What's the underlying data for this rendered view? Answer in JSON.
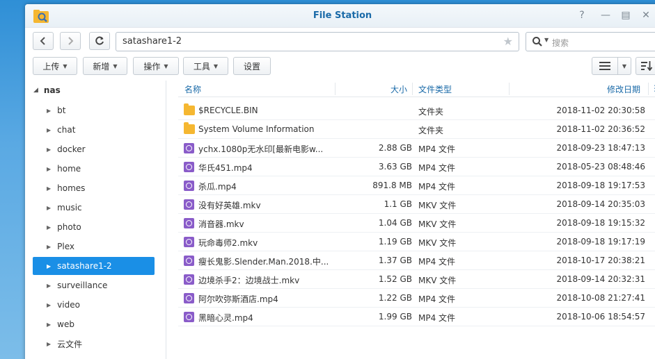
{
  "window": {
    "title": "File Station"
  },
  "address": {
    "path": "satashare1-2"
  },
  "search": {
    "placeholder": "搜索"
  },
  "toolbar": {
    "upload": "上传",
    "create": "新增",
    "action": "操作",
    "tools": "工具",
    "settings": "设置"
  },
  "sidebar": {
    "root": "nas",
    "items": [
      {
        "label": "bt"
      },
      {
        "label": "chat"
      },
      {
        "label": "docker"
      },
      {
        "label": "home"
      },
      {
        "label": "homes"
      },
      {
        "label": "music"
      },
      {
        "label": "photo"
      },
      {
        "label": "Plex"
      },
      {
        "label": "satashare1-2"
      },
      {
        "label": "surveillance"
      },
      {
        "label": "video"
      },
      {
        "label": "web"
      },
      {
        "label": "云文件"
      }
    ],
    "selected": "satashare1-2"
  },
  "columns": {
    "name": "名称",
    "size": "大小",
    "type": "文件类型",
    "modified": "修改日期"
  },
  "files": [
    {
      "icon": "folder-icon",
      "name": "$RECYCLE.BIN",
      "size": "",
      "type": "文件夹",
      "modified": "2018-11-02 20:30:58"
    },
    {
      "icon": "folder-icon",
      "name": "System Volume Information",
      "size": "",
      "type": "文件夹",
      "modified": "2018-11-02 20:36:52"
    },
    {
      "icon": "video-file-icon",
      "name": "ychx.1080p无水印[最新电影w...",
      "size": "2.88 GB",
      "type": "MP4 文件",
      "modified": "2018-09-23 18:47:13"
    },
    {
      "icon": "video-file-icon",
      "name": "华氏451.mp4",
      "size": "3.63 GB",
      "type": "MP4 文件",
      "modified": "2018-05-23 08:48:46"
    },
    {
      "icon": "video-file-icon",
      "name": "杀瓜.mp4",
      "size": "891.8 MB",
      "type": "MP4 文件",
      "modified": "2018-09-18 19:17:53"
    },
    {
      "icon": "video-file-icon",
      "name": "没有好英雄.mkv",
      "size": "1.1 GB",
      "type": "MKV 文件",
      "modified": "2018-09-14 20:35:03"
    },
    {
      "icon": "video-file-icon",
      "name": "消音器.mkv",
      "size": "1.04 GB",
      "type": "MKV 文件",
      "modified": "2018-09-18 19:15:32"
    },
    {
      "icon": "video-file-icon",
      "name": "玩命毒师2.mkv",
      "size": "1.19 GB",
      "type": "MKV 文件",
      "modified": "2018-09-18 19:17:19"
    },
    {
      "icon": "video-file-icon",
      "name": "瘦长鬼影.Slender.Man.2018.中...",
      "size": "1.37 GB",
      "type": "MP4 文件",
      "modified": "2018-10-17 20:38:21"
    },
    {
      "icon": "video-file-icon",
      "name": "边境杀手2：边境战士.mkv",
      "size": "1.52 GB",
      "type": "MKV 文件",
      "modified": "2018-09-14 20:32:31"
    },
    {
      "icon": "video-file-icon",
      "name": "阿尔吹弥斯酒店.mp4",
      "size": "1.22 GB",
      "type": "MP4 文件",
      "modified": "2018-10-08 21:27:41"
    },
    {
      "icon": "video-file-icon",
      "name": "黑暗心灵.mp4",
      "size": "1.99 GB",
      "type": "MP4 文件",
      "modified": "2018-10-06 18:54:57"
    }
  ]
}
